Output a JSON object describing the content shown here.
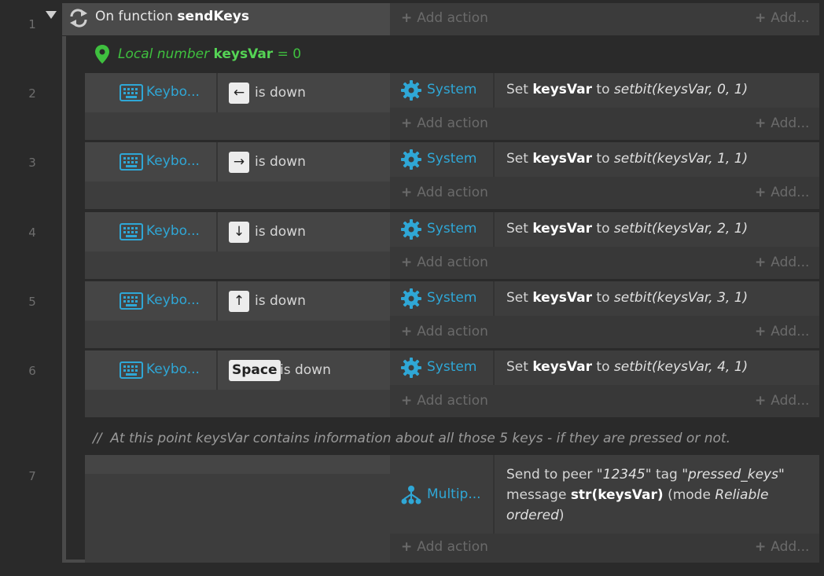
{
  "line_numbers": [
    "1",
    "2",
    "3",
    "4",
    "5",
    "6",
    "7"
  ],
  "function_block": {
    "prefix": "On function",
    "name": "sendKeys",
    "add_action": "Add action",
    "add_more": "Add..."
  },
  "local_var": {
    "prefix": "Local number",
    "name": "keysVar",
    "equals": "= 0"
  },
  "events": [
    {
      "object": "Keybo...",
      "key": "←",
      "condition": "is down",
      "action_object": "System",
      "action_prefix": "Set",
      "action_var": "keysVar",
      "action_to": "to",
      "action_expr": "setbit(keysVar, 0, 1)",
      "add_action": "Add action",
      "add_more": "Add..."
    },
    {
      "object": "Keybo...",
      "key": "→",
      "condition": "is down",
      "action_object": "System",
      "action_prefix": "Set",
      "action_var": "keysVar",
      "action_to": "to",
      "action_expr": "setbit(keysVar, 1, 1)",
      "add_action": "Add action",
      "add_more": "Add..."
    },
    {
      "object": "Keybo...",
      "key": "↓",
      "condition": "is down",
      "action_object": "System",
      "action_prefix": "Set",
      "action_var": "keysVar",
      "action_to": "to",
      "action_expr": "setbit(keysVar, 2, 1)",
      "add_action": "Add action",
      "add_more": "Add..."
    },
    {
      "object": "Keybo...",
      "key": "↑",
      "condition": "is down",
      "action_object": "System",
      "action_prefix": "Set",
      "action_var": "keysVar",
      "action_to": "to",
      "action_expr": "setbit(keysVar, 3, 1)",
      "add_action": "Add action",
      "add_more": "Add..."
    },
    {
      "object": "Keybo...",
      "key": "Space",
      "condition": "is down",
      "action_object": "System",
      "action_prefix": "Set",
      "action_var": "keysVar",
      "action_to": "to",
      "action_expr": "setbit(keysVar, 4, 1)",
      "add_action": "Add action",
      "add_more": "Add..."
    }
  ],
  "comment": {
    "slashes": "//",
    "text": "At this point keysVar contains information about all those 5 keys - if they are pressed or not."
  },
  "multiplayer_event": {
    "action_object": "Multip...",
    "p1": "Send to peer \"",
    "peer": "12345",
    "p2": "\" tag ",
    "tag": "\"pressed_keys\"",
    "p3": "message",
    "message": "str(keysVar)",
    "p4": "(mode",
    "mode": "Reliable ordered",
    "p5": ")",
    "add_action": "Add action",
    "add_more": "Add..."
  },
  "colors": {
    "accent_blue": "#2fa7d6",
    "local_green": "#3fc03f",
    "background": "#2a2a2a"
  }
}
